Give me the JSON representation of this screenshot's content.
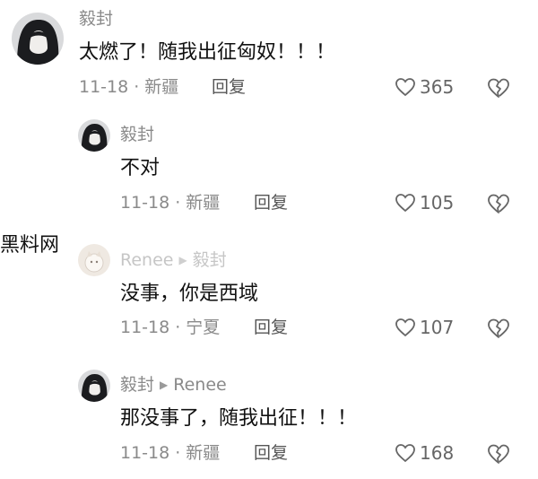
{
  "watermark": "黑料网",
  "comments": [
    {
      "user": "毅封",
      "reply_to": "",
      "text": "太燃了！随我出征匈奴！！！",
      "date": "11-18",
      "location": "新疆",
      "reply_label": "回复",
      "likes": "365",
      "avatar": "dark-hair"
    },
    {
      "user": "毅封",
      "reply_to": "",
      "text": "不对",
      "date": "11-18",
      "location": "新疆",
      "reply_label": "回复",
      "likes": "105",
      "avatar": "dark-hair"
    },
    {
      "user": "Renee",
      "reply_to": "毅封",
      "text": "没事，你是西域",
      "date": "11-18",
      "location": "宁夏",
      "reply_label": "回复",
      "likes": "107",
      "avatar": "light-cat"
    },
    {
      "user": "毅封",
      "reply_to": "Renee",
      "text": "那没事了，随我出征！！！",
      "date": "11-18",
      "location": "新疆",
      "reply_label": "回复",
      "likes": "168",
      "avatar": "dark-hair"
    }
  ],
  "meta_separator": "·",
  "reply_arrow": "▶",
  "icons": {
    "like": "heart-outline-icon",
    "dislike": "broken-heart-icon"
  },
  "colors": {
    "text": "#111111",
    "muted": "#8a8a8a",
    "faded": "#c6c6c6"
  }
}
